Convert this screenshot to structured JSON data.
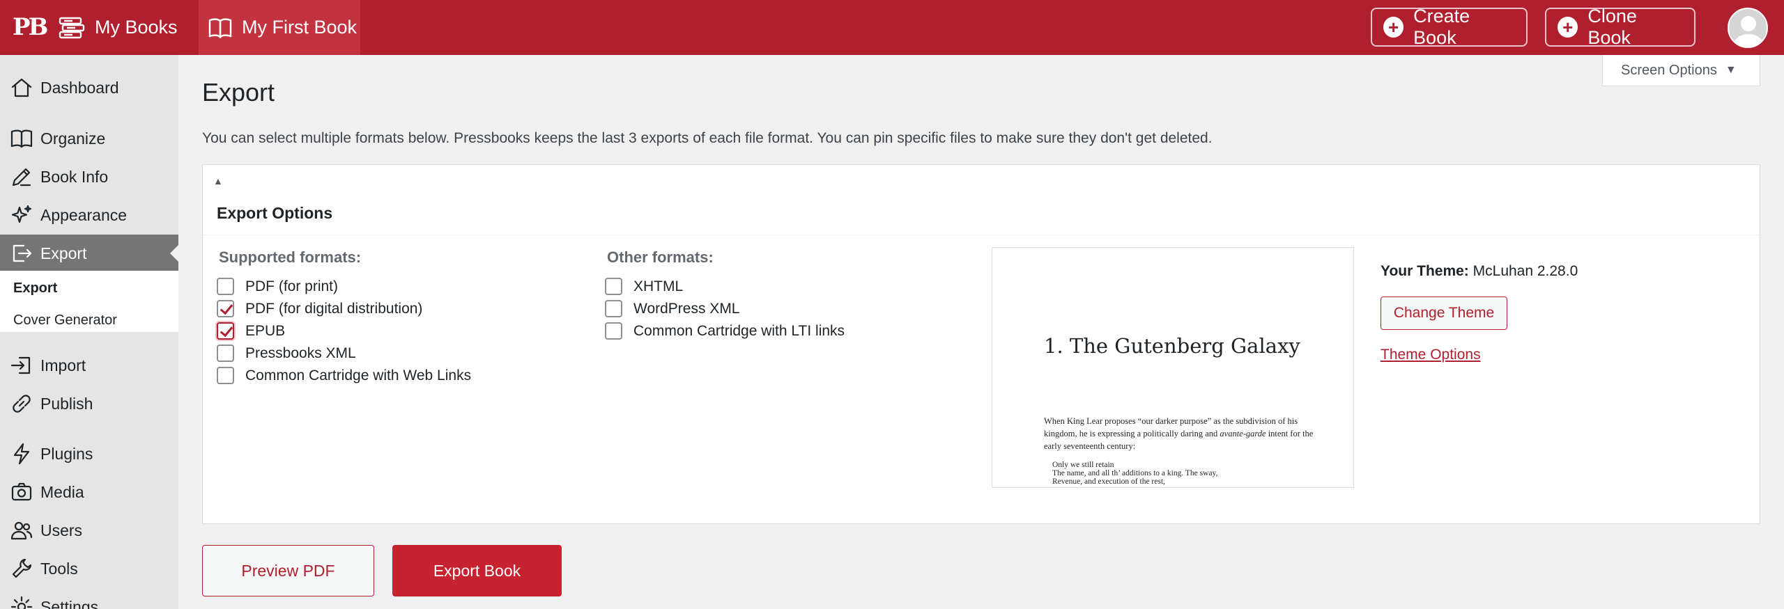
{
  "topbar": {
    "logo": "PB",
    "my_books": "My Books",
    "book_title": "My First Book",
    "create_book": "Create Book",
    "clone_book": "Clone Book"
  },
  "sidebar": {
    "items": [
      {
        "label": "Dashboard",
        "icon": "home-icon"
      },
      {
        "label": "Organize",
        "icon": "book-open-icon"
      },
      {
        "label": "Book Info",
        "icon": "pencil-icon"
      },
      {
        "label": "Appearance",
        "icon": "sparkles-icon"
      },
      {
        "label": "Export",
        "icon": "export-icon",
        "active": true
      },
      {
        "label": "Import",
        "icon": "import-icon"
      },
      {
        "label": "Publish",
        "icon": "link-icon"
      },
      {
        "label": "Plugins",
        "icon": "bolt-icon"
      },
      {
        "label": "Media",
        "icon": "camera-icon"
      },
      {
        "label": "Users",
        "icon": "users-icon"
      },
      {
        "label": "Tools",
        "icon": "wrench-icon"
      },
      {
        "label": "Settings",
        "icon": "gear-icon"
      }
    ],
    "submenu": [
      {
        "label": "Export",
        "current": true
      },
      {
        "label": "Cover Generator"
      }
    ]
  },
  "screen_options": "Screen Options",
  "page": {
    "title": "Export",
    "intro": "You can select multiple formats below. Pressbooks keeps the last 3 exports of each file format. You can pin specific files to make sure they don't get deleted."
  },
  "export_options": {
    "title": "Export Options",
    "supported_label": "Supported formats:",
    "supported": [
      {
        "label": "PDF (for print)",
        "checked": false
      },
      {
        "label": "PDF (for digital distribution)",
        "checked": true
      },
      {
        "label": "EPUB",
        "checked": true
      },
      {
        "label": "Pressbooks XML",
        "checked": false
      },
      {
        "label": "Common Cartridge with Web Links",
        "checked": false
      }
    ],
    "other_label": "Other formats:",
    "other": [
      {
        "label": "XHTML",
        "checked": false
      },
      {
        "label": "WordPress XML",
        "checked": false
      },
      {
        "label": "Common Cartridge with LTI links",
        "checked": false
      }
    ]
  },
  "preview": {
    "heading": "1. The Gutenberg Galaxy",
    "para_1": "When King Lear proposes “our darker purpose” as the subdivision of his kingdom, he is expressing a politically daring and ",
    "para_em": "avante-garde",
    "para_2": " intent for the early seventeenth century:",
    "quote_1": "Only we still retain",
    "quote_2": "The name, and all th’ additions to a king. The sway,",
    "quote_3": "Revenue, and execution of the rest,"
  },
  "theme": {
    "label": "Your Theme:",
    "name": "McLuhan 2.28.0",
    "change_button": "Change Theme",
    "options_link": "Theme Options"
  },
  "actions": {
    "preview_pdf": "Preview PDF",
    "export_book": "Export Book"
  },
  "colors": {
    "brand": "#b01f2e",
    "active_menu": "#757575"
  }
}
